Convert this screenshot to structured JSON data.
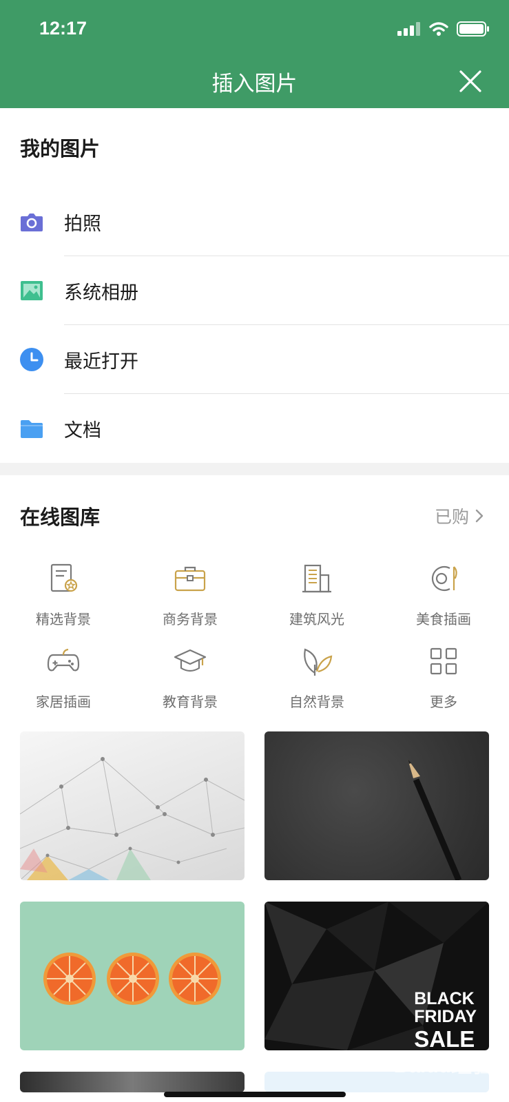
{
  "status_bar": {
    "time": "12:17"
  },
  "header": {
    "title": "插入图片"
  },
  "my_pictures": {
    "title": "我的图片",
    "items": [
      {
        "label": "拍照",
        "icon": "camera-icon",
        "color": "#6a6fd6"
      },
      {
        "label": "系统相册",
        "icon": "gallery-icon",
        "color": "#3fbf8f"
      },
      {
        "label": "最近打开",
        "icon": "clock-icon",
        "color": "#3d8ff0"
      },
      {
        "label": "文档",
        "icon": "folder-icon",
        "color": "#4aa0f2"
      }
    ]
  },
  "online_gallery": {
    "title": "在线图库",
    "purchased_label": "已购",
    "categories": [
      {
        "label": "精选背景",
        "icon": "featured-doc-icon"
      },
      {
        "label": "商务背景",
        "icon": "briefcase-icon"
      },
      {
        "label": "建筑风光",
        "icon": "building-icon"
      },
      {
        "label": "美食插画",
        "icon": "food-plate-icon"
      },
      {
        "label": "家居插画",
        "icon": "gamepad-icon"
      },
      {
        "label": "教育背景",
        "icon": "graduation-cap-icon"
      },
      {
        "label": "自然背景",
        "icon": "leaf-icon"
      },
      {
        "label": "更多",
        "icon": "grid-icon"
      }
    ],
    "thumbnails": [
      {
        "name": "geometric-white-thumbnail"
      },
      {
        "name": "pencil-dark-thumbnail"
      },
      {
        "name": "orange-slices-thumbnail"
      },
      {
        "name": "black-friday-thumbnail",
        "text_lines": [
          "BLACK",
          "FRIDAY",
          "SALE"
        ]
      }
    ]
  },
  "watermark": "Baidu经验",
  "colors": {
    "header_bg": "#3f9b66",
    "accent_gold": "#c9a24a"
  }
}
